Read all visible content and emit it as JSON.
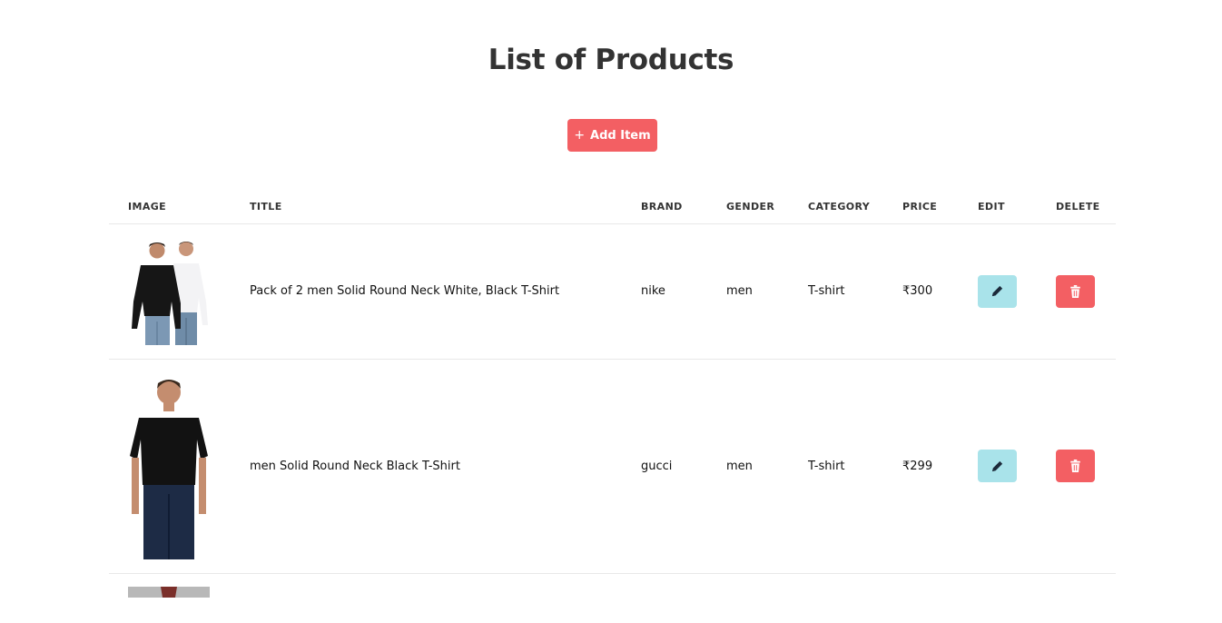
{
  "page": {
    "title": "List of Products"
  },
  "toolbar": {
    "add_icon": "+",
    "add_label": "Add Item"
  },
  "table": {
    "columns": {
      "image": "IMAGE",
      "title": "TITLE",
      "brand": "BRAND",
      "gender": "GENDER",
      "category": "CATEGORY",
      "price": "PRICE",
      "edit": "EDIT",
      "delete": "DELETE"
    },
    "rows": [
      {
        "image_icon": "two-men-long-sleeve-tshirts-photo",
        "title": "Pack of 2 men Solid Round Neck White, Black T-Shirt",
        "brand": "nike",
        "gender": "men",
        "category": "T-shirt",
        "price": "₹300",
        "edit_icon": "pencil-icon",
        "delete_icon": "trash-icon"
      },
      {
        "image_icon": "man-black-tshirt-photo",
        "title": "men Solid Round Neck Black T-Shirt",
        "brand": "gucci",
        "gender": "men",
        "category": "T-shirt",
        "price": "₹299",
        "edit_icon": "pencil-icon",
        "delete_icon": "trash-icon"
      }
    ]
  },
  "colors": {
    "accent": "#f35f63",
    "edit_button": "#a9e3ea",
    "text": "#333333",
    "border": "#e8e8e8"
  }
}
